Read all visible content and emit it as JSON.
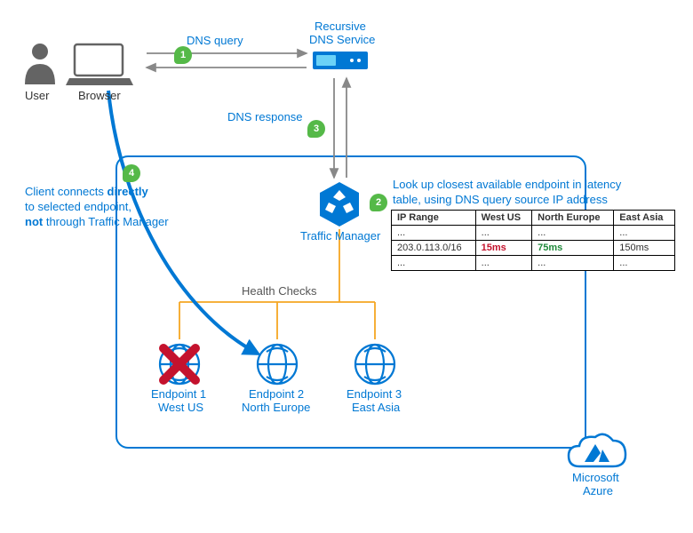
{
  "labels": {
    "user": "User",
    "browser": "Browser",
    "dns_top": "Recursive",
    "dns_bot": "DNS Service",
    "tm": "Traffic Manager",
    "ep1_a": "Endpoint 1",
    "ep1_b": "West US",
    "ep2_a": "Endpoint 2",
    "ep2_b": "North Europe",
    "ep3_a": "Endpoint 3",
    "ep3_b": "East Asia",
    "azure_a": "Microsoft",
    "azure_b": "Azure",
    "health": "Health Checks"
  },
  "steps": {
    "s1": {
      "num": "1",
      "text": "DNS query"
    },
    "s2": {
      "num": "2",
      "text_a": "Look up closest available endpoint in latency",
      "text_b": "table, using DNS query source IP address"
    },
    "s3": {
      "num": "3",
      "text": "DNS response"
    },
    "s4": {
      "num": "4",
      "text_a": "Client connects ",
      "text_b": "directly",
      "text_c": " to selected endpoint, ",
      "text_d": "not",
      "text_e": " through Traffic Manager"
    }
  },
  "table": {
    "headers": {
      "c0": "IP Range",
      "c1": "West US",
      "c2": "North Europe",
      "c3": "East Asia"
    },
    "r0": {
      "c0": "...",
      "c1": "...",
      "c2": "...",
      "c3": "..."
    },
    "r1": {
      "c0": "203.0.113.0/16",
      "c1": "15ms",
      "c2": "75ms",
      "c3": "150ms"
    },
    "r2": {
      "c0": "...",
      "c1": "...",
      "c2": "...",
      "c3": "..."
    }
  }
}
